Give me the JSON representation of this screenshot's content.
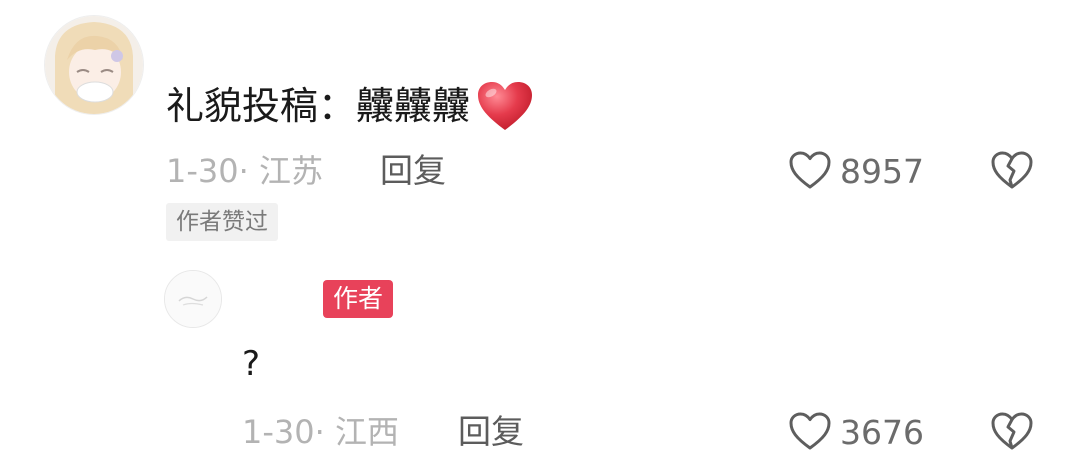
{
  "colors": {
    "author_badge_bg": "#e8425a",
    "heart_emoji": "#e53b4c",
    "meta_text": "#b3b3b3"
  },
  "main_comment": {
    "avatar_icon": "anime-avatar",
    "text": "礼貌投稿：",
    "emoji_text": "齉齉齉",
    "emoji_icon": "red-heart-emoji",
    "date_location": "1-30· 江苏",
    "reply_label": "回复",
    "like_icon": "heart-outline-icon",
    "like_count": "8957",
    "dislike_icon": "broken-heart-icon",
    "author_liked_badge": "作者赞过"
  },
  "reply_comment": {
    "avatar_icon": "blank-avatar",
    "author_badge": "作者",
    "text": "?",
    "date_location": "1-30· 江西",
    "reply_label": "回复",
    "like_icon": "heart-outline-icon",
    "like_count": "3676",
    "dislike_icon": "broken-heart-icon"
  }
}
